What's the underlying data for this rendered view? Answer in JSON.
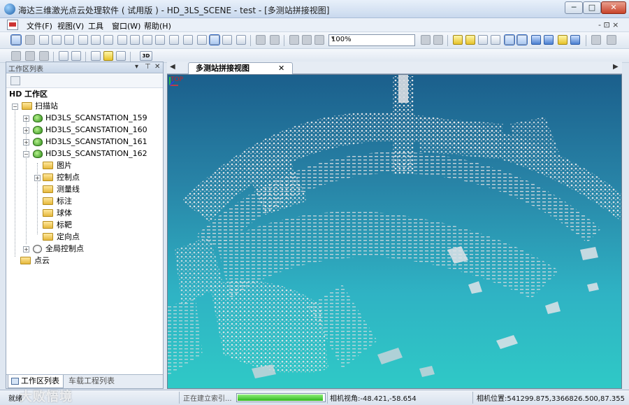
{
  "window": {
    "title": "海达三维激光点云处理软件 ( 试用版 ) - HD_3LS_SCENE - test - [多测站拼接视图]",
    "min_label": "─",
    "max_label": "□",
    "close_label": "✕"
  },
  "menu": {
    "items": [
      "文件(F)",
      "视图(V)",
      "工具",
      "窗口(W)",
      "帮助(H)"
    ],
    "right_controls": "-  ⊡  ×"
  },
  "toolbar": {
    "zoom_value": "100%",
    "zoom_arrow": "▾",
    "tb2_3d_label": "3D"
  },
  "panel": {
    "title": "工作区列表",
    "controls": [
      "▾",
      "⊤",
      "✕"
    ]
  },
  "tree": {
    "root": "工作区",
    "root_prefix": "HD",
    "scan_group": "扫描站",
    "stations": [
      "HD3LS_SCANSTATION_159",
      "HD3LS_SCANSTATION_160",
      "HD3LS_SCANSTATION_161",
      "HD3LS_SCANSTATION_162"
    ],
    "children": [
      "图片",
      "控制点",
      "测量线",
      "标注",
      "球体",
      "标靶",
      "定向点"
    ],
    "global_control": "全局控制点",
    "point_cloud": "点云"
  },
  "panel_tabs": {
    "active": "工作区列表",
    "inactive": "车载工程列表"
  },
  "doc_tabs": {
    "left_nav": "◀",
    "active": "多测站拼接视图",
    "close": "✕",
    "right_nav": "▶"
  },
  "viewport": {
    "label": "TOP"
  },
  "status": {
    "ready": "就绪",
    "indexing": "正在建立索引...",
    "progress_fraction": 0.98,
    "camera_view": "相机视角:-48.421,-58.654",
    "camera_position": "相机位置:541299.875,3366826.500,87.355"
  },
  "watermark": "大败悟境",
  "colors": {
    "viewport_top": "#1b5f8c",
    "viewport_bottom": "#2fc9c6",
    "progress": "#2fb51d",
    "station_icon": "#2f8d1a"
  }
}
